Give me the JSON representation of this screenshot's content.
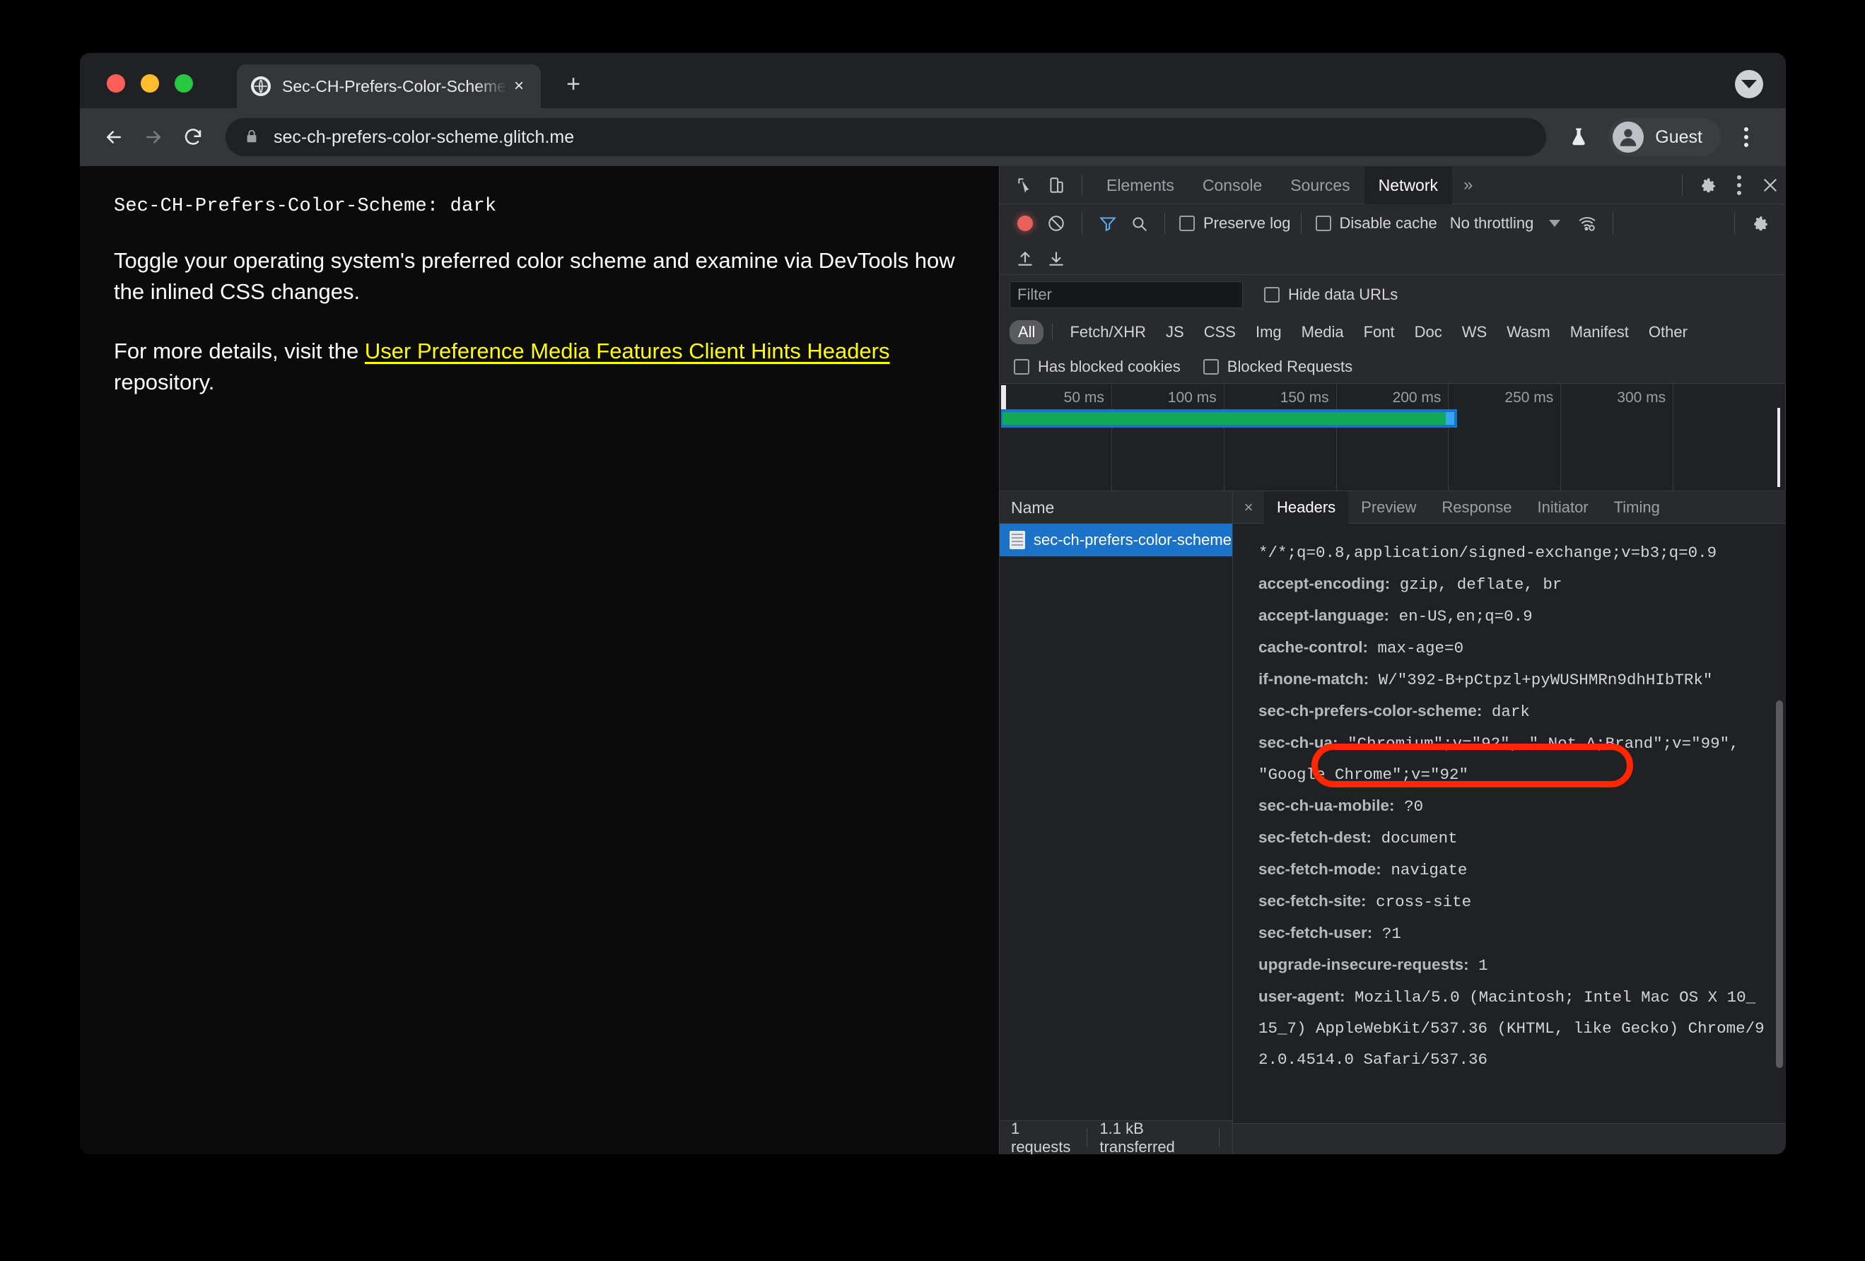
{
  "browser": {
    "tab": {
      "title": "Sec-CH-Prefers-Color-Scheme",
      "favicon": "globe-icon",
      "close": "×"
    },
    "new_tab": "+",
    "window_dropdown": "chevron-down-icon",
    "omnibox": {
      "url": "sec-ch-prefers-color-scheme.glitch.me",
      "lock": "lock-icon"
    },
    "flask": "flask-icon",
    "profile": {
      "label": "Guest",
      "avatar": "person-icon"
    },
    "menu": "kebab-menu-icon"
  },
  "page": {
    "header_line": "Sec-CH-Prefers-Color-Scheme: dark",
    "paragraph1": "Toggle your operating system's preferred color scheme and examine via DevTools how the inlined CSS changes.",
    "paragraph2_before": "For more details, visit the ",
    "link_text": "User Preference Media Features Client Hints Headers",
    "paragraph2_after": " repository.",
    "link_color": "#ffff00"
  },
  "devtools": {
    "panel_tabs": [
      {
        "label": "Elements",
        "active": false
      },
      {
        "label": "Console",
        "active": false
      },
      {
        "label": "Sources",
        "active": false
      },
      {
        "label": "Network",
        "active": true
      }
    ],
    "more_tabs": "»",
    "left_icons": [
      "inspect-icon",
      "device-toggle-icon"
    ],
    "right_icons": [
      "gear-icon",
      "kebab-menu-icon",
      "close-icon"
    ],
    "network_toolbar": {
      "record": "record-icon",
      "clear": "clear-icon",
      "filter": "filter-icon",
      "search": "search-icon",
      "preserve_log": "Preserve log",
      "disable_cache": "Disable cache",
      "throttling": "No throttling",
      "throttling_caret": "chevron-down-icon",
      "network_conditions": "wifi-settings-icon",
      "settings": "gear-icon",
      "import_har": "import-har-icon",
      "export_har": "export-har-icon"
    },
    "filter_row": {
      "placeholder": "Filter",
      "value": "",
      "hide_data_urls": "Hide data URLs"
    },
    "type_filters": [
      {
        "label": "All",
        "active": true
      },
      {
        "label": "Fetch/XHR",
        "active": false
      },
      {
        "label": "JS",
        "active": false
      },
      {
        "label": "CSS",
        "active": false
      },
      {
        "label": "Img",
        "active": false
      },
      {
        "label": "Media",
        "active": false
      },
      {
        "label": "Font",
        "active": false
      },
      {
        "label": "Doc",
        "active": false
      },
      {
        "label": "WS",
        "active": false
      },
      {
        "label": "Wasm",
        "active": false
      },
      {
        "label": "Manifest",
        "active": false
      },
      {
        "label": "Other",
        "active": false
      }
    ],
    "blocked_filters": [
      {
        "label": "Has blocked cookies"
      },
      {
        "label": "Blocked Requests"
      }
    ],
    "overview": {
      "ticks": [
        "50 ms",
        "100 ms",
        "150 ms",
        "200 ms",
        "250 ms",
        "300 ms"
      ],
      "bar_color_outer": "#1a73c8",
      "bar_color_inner": "#0fa958"
    },
    "requests": {
      "column_header": "Name",
      "rows": [
        {
          "name": "sec-ch-prefers-color-scheme…",
          "icon": "document-icon",
          "selected": true
        }
      ],
      "status": {
        "count": "1 requests",
        "transferred": "1.1 kB transferred"
      }
    },
    "detail": {
      "close": "×",
      "tabs": [
        {
          "label": "Headers",
          "active": true
        },
        {
          "label": "Preview",
          "active": false
        },
        {
          "label": "Response",
          "active": false
        },
        {
          "label": "Initiator",
          "active": false
        },
        {
          "label": "Timing",
          "active": false
        }
      ],
      "headers": [
        {
          "name": "",
          "value": "*/*;q=0.8,application/signed-exchange;v=b3;q=0.9",
          "highlight": false
        },
        {
          "name": "accept-encoding:",
          "value": "gzip, deflate, br",
          "highlight": false
        },
        {
          "name": "accept-language:",
          "value": "en-US,en;q=0.9",
          "highlight": false
        },
        {
          "name": "cache-control:",
          "value": "max-age=0",
          "highlight": false
        },
        {
          "name": "if-none-match:",
          "value": "W/\"392-B+pCtpzl+pyWUSHMRn9dhHIbTRk\"",
          "highlight": false
        },
        {
          "name": "sec-ch-prefers-color-scheme:",
          "value": "dark",
          "highlight": true
        },
        {
          "name": "sec-ch-ua:",
          "value": "\"Chromium\";v=\"92\", \" Not A;Brand\";v=\"99\", \"Google Chrome\";v=\"92\"",
          "highlight": false
        },
        {
          "name": "sec-ch-ua-mobile:",
          "value": "?0",
          "highlight": false
        },
        {
          "name": "sec-fetch-dest:",
          "value": "document",
          "highlight": false
        },
        {
          "name": "sec-fetch-mode:",
          "value": "navigate",
          "highlight": false
        },
        {
          "name": "sec-fetch-site:",
          "value": "cross-site",
          "highlight": false
        },
        {
          "name": "sec-fetch-user:",
          "value": "?1",
          "highlight": false
        },
        {
          "name": "upgrade-insecure-requests:",
          "value": "1",
          "highlight": false
        },
        {
          "name": "user-agent:",
          "value": "Mozilla/5.0 (Macintosh; Intel Mac OS X 10_15_7) AppleWebKit/537.36 (KHTML, like Gecko) Chrome/92.0.4514.0 Safari/537.36",
          "highlight": false
        }
      ]
    }
  },
  "annotation": {
    "shape": "ellipse-highlight",
    "color": "#ff2600",
    "target": "sec-ch-prefers-color-scheme: dark"
  }
}
